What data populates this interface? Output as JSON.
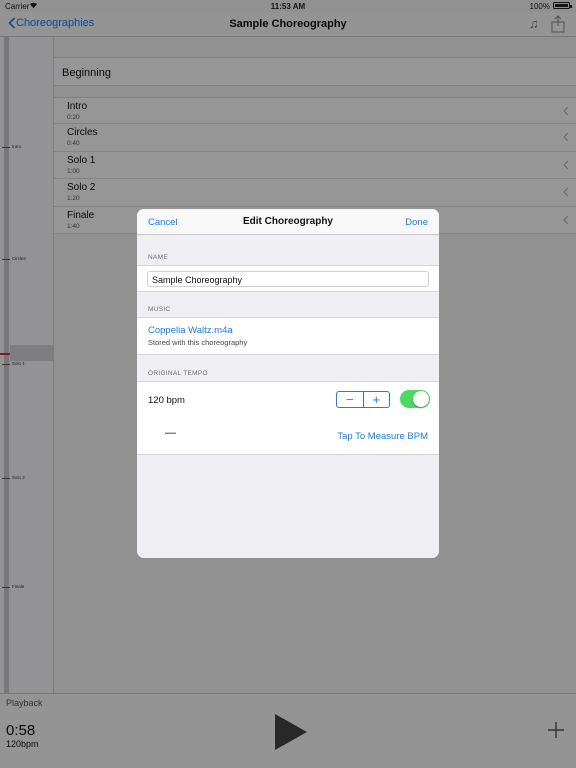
{
  "status": {
    "carrier": "Carrier",
    "time": "11:53 AM",
    "battery": "100%"
  },
  "nav": {
    "back_label": "Choreographies",
    "title": "Sample Choreography",
    "music_icon": "music-note-icon",
    "share_icon": "share-icon"
  },
  "timeline": {
    "markers": [
      "Intro",
      "Circles",
      "Solo 1",
      "Solo 2",
      "Finale"
    ]
  },
  "sections": {
    "header": "Beginning",
    "rows": [
      {
        "name": "Intro",
        "time": "0:20"
      },
      {
        "name": "Circles",
        "time": "0:40"
      },
      {
        "name": "Solo 1",
        "time": "1:00"
      },
      {
        "name": "Solo 2",
        "time": "1:20"
      },
      {
        "name": "Finale",
        "time": "1:40"
      }
    ]
  },
  "toolbar": {
    "playback_label": "Playback",
    "time": "0:58",
    "bpm": "120bpm",
    "play_icon": "play-icon",
    "add_icon": "plus-icon"
  },
  "modal": {
    "cancel": "Cancel",
    "title": "Edit Choreography",
    "done": "Done",
    "name_label": "NAME",
    "name_value": "Sample Choreography",
    "music_label": "MUSIC",
    "music_file": "Coppelia Waltz.m4a",
    "music_note": "Stored with this choreography",
    "tempo_label": "ORIGINAL TEMPO",
    "tempo_value": "120 bpm",
    "stepper_minus": "−",
    "stepper_plus": "+",
    "tempo_enabled": true,
    "measure_display": "—",
    "measure_button": "Tap To Measure BPM"
  },
  "colors": {
    "accent": "#1a7cf5",
    "toggle_on": "#4cd964",
    "playhead": "#d0302a"
  }
}
